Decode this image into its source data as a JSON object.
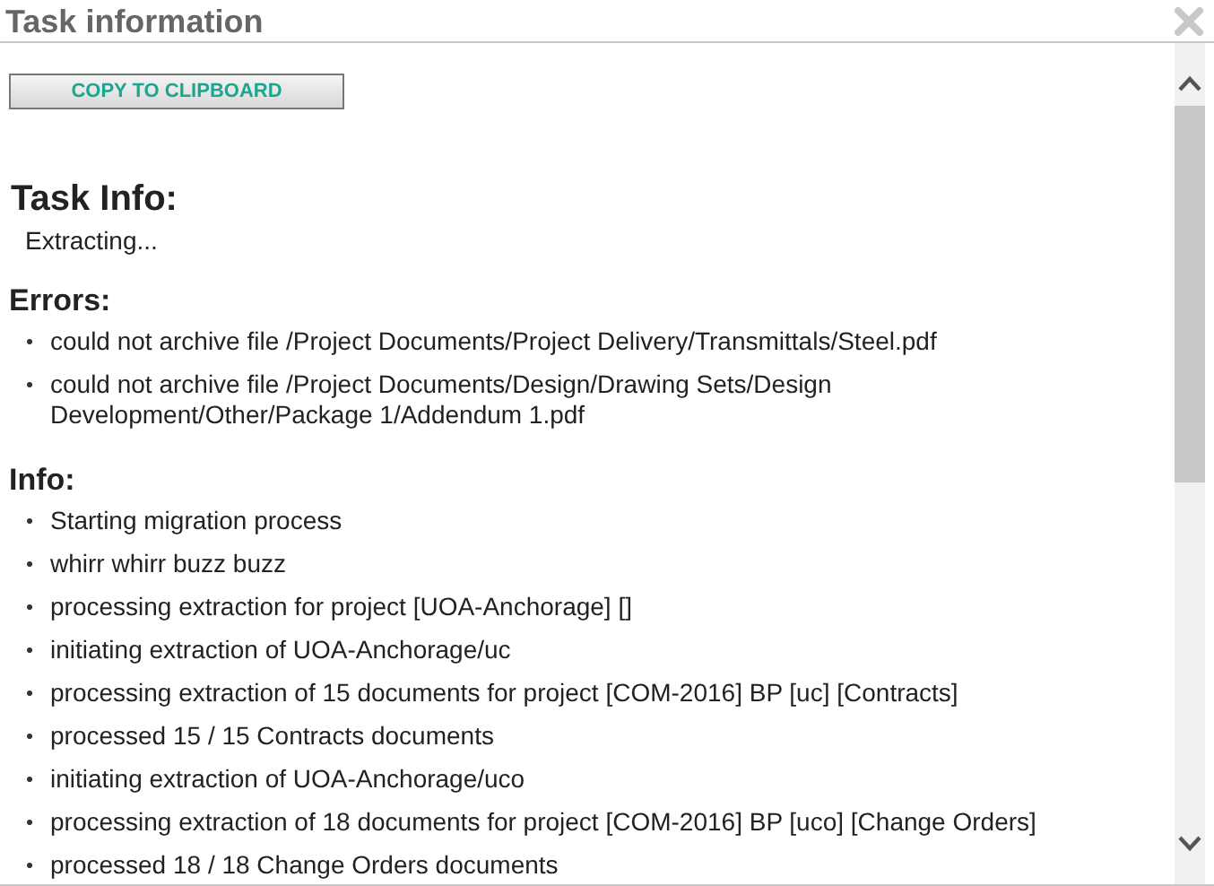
{
  "window": {
    "title": "Task information"
  },
  "copy_button": {
    "label": "COPY TO CLIPBOARD"
  },
  "task_info": {
    "heading": "Task Info:",
    "status": "Extracting..."
  },
  "errors": {
    "heading": "Errors:",
    "items": [
      "could not archive file /Project Documents/Project Delivery/Transmittals/Steel.pdf",
      "could not archive file /Project Documents/Design/Drawing Sets/Design Development/Other/Package 1/Addendum 1.pdf"
    ]
  },
  "info": {
    "heading": "Info:",
    "items": [
      "Starting migration process",
      "whirr whirr buzz buzz",
      "processing extraction for project [UOA-Anchorage] []",
      "initiating extraction of UOA-Anchorage/uc",
      "processing extraction of 15 documents for project [COM-2016] BP [uc] [Contracts]",
      "processed 15 / 15 Contracts documents",
      "initiating extraction of UOA-Anchorage/uco",
      "processing extraction of 18 documents for project [COM-2016] BP [uco] [Change Orders]",
      "processed 18 / 18 Change Orders documents"
    ]
  }
}
